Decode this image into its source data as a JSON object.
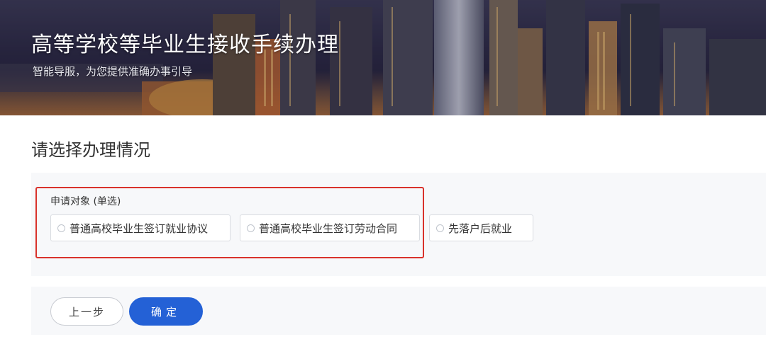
{
  "banner": {
    "title": "高等学校等毕业生接收手续办理",
    "subtitle": "智能导服，为您提供准确办事引导"
  },
  "section": {
    "title": "请选择办理情况"
  },
  "applicant": {
    "label": "申请对象 (单选)",
    "options": [
      {
        "label": "普通高校毕业生签订就业协议",
        "selected": false
      },
      {
        "label": "普通高校毕业生签订劳动合同",
        "selected": false
      },
      {
        "label": "先落户后就业",
        "selected": false
      }
    ]
  },
  "actions": {
    "prev_label": "上一步",
    "confirm_label": "确定"
  },
  "colors": {
    "accent": "#2461d6",
    "highlight_border": "#d9322b"
  }
}
